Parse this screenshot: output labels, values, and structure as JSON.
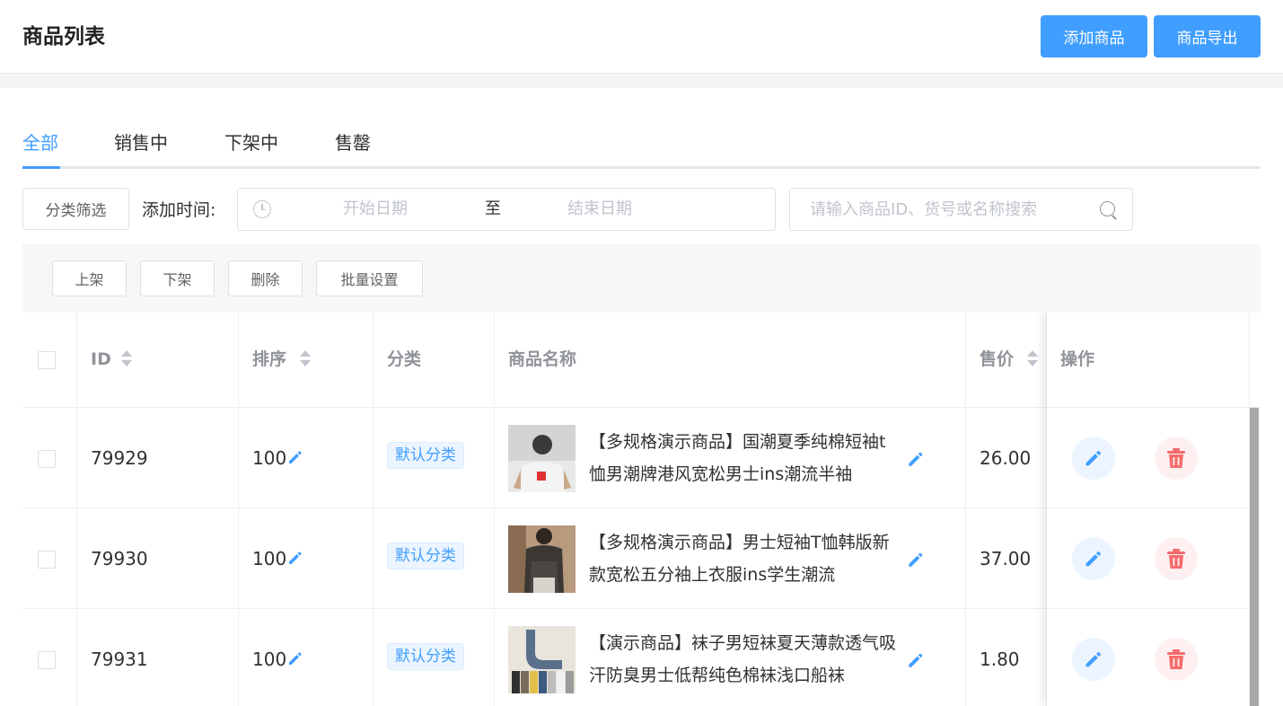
{
  "header": {
    "title": "商品列表",
    "add_button": "添加商品",
    "export_button": "商品导出"
  },
  "tabs": [
    {
      "label": "全部",
      "active": true
    },
    {
      "label": "销售中",
      "active": false
    },
    {
      "label": "下架中",
      "active": false
    },
    {
      "label": "售罄",
      "active": false
    }
  ],
  "filters": {
    "category_button": "分类筛选",
    "time_label": "添加时间:",
    "start_placeholder": "开始日期",
    "separator": "至",
    "end_placeholder": "结束日期",
    "search_placeholder": "请输入商品ID、货号或名称搜索"
  },
  "batch_actions": {
    "on_shelf": "上架",
    "off_shelf": "下架",
    "delete": "删除",
    "batch_settings": "批量设置"
  },
  "table": {
    "columns": {
      "id": "ID",
      "sort": "排序",
      "category": "分类",
      "name": "商品名称",
      "price": "售价",
      "actions": "操作"
    },
    "rows": [
      {
        "id": "79929",
        "sort": "100",
        "category": "默认分类",
        "name": "【多规格演示商品】国潮夏季纯棉短袖t恤男潮牌港风宽松男士ins潮流半袖",
        "price": "26.00"
      },
      {
        "id": "79930",
        "sort": "100",
        "category": "默认分类",
        "name": "【多规格演示商品】男士短袖T恤韩版新款宽松五分袖上衣服ins学生潮流",
        "price": "37.00"
      },
      {
        "id": "79931",
        "sort": "100",
        "category": "默认分类",
        "name": "【演示商品】袜子男短袜夏天薄款透气吸汗防臭男士低帮纯色棉袜浅口船袜",
        "price": "1.80"
      }
    ]
  },
  "colors": {
    "primary": "#409eff",
    "danger": "#f56c6c"
  }
}
